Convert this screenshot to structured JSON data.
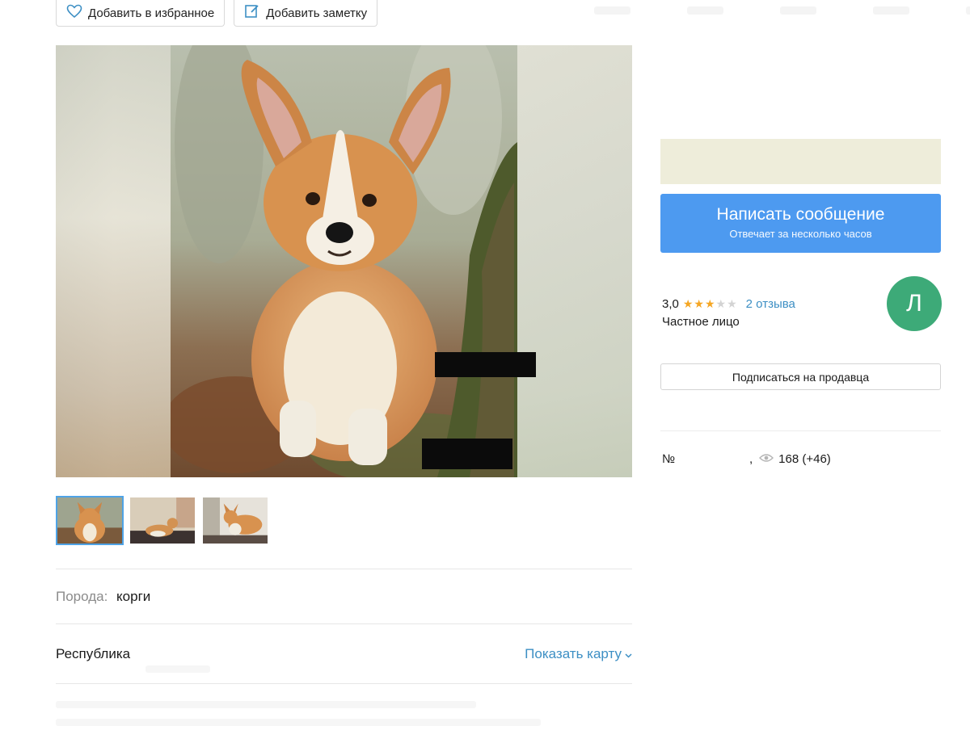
{
  "top_actions": {
    "favorite_label": "Добавить в избранное",
    "note_label": "Добавить заметку"
  },
  "params": {
    "breed_label": "Порода:",
    "breed_value": "корги"
  },
  "location": {
    "region": "Республика",
    "show_map": "Показать карту"
  },
  "contact": {
    "message_title": "Написать сообщение",
    "message_subtitle": "Отвечает за несколько часов"
  },
  "seller": {
    "rating": "3,0",
    "stars_filled": 3,
    "stars_total": 5,
    "reviews": "2 отзыва",
    "type": "Частное лицо",
    "avatar_letter": "Л",
    "subscribe_label": "Подписаться на продавца"
  },
  "listing_meta": {
    "number_prefix": "№",
    "comma": ",",
    "views": "168 (+46)"
  },
  "colors": {
    "primary_button": "#4d9af0",
    "link": "#3d8fc4",
    "avatar": "#3daa78",
    "star": "#f5a623",
    "price_box": "#eeedda"
  },
  "icons": {
    "favorite": "heart-outline-icon",
    "note": "note-edit-icon",
    "views": "eye-icon",
    "map_chevron": "chevron-down-icon"
  }
}
